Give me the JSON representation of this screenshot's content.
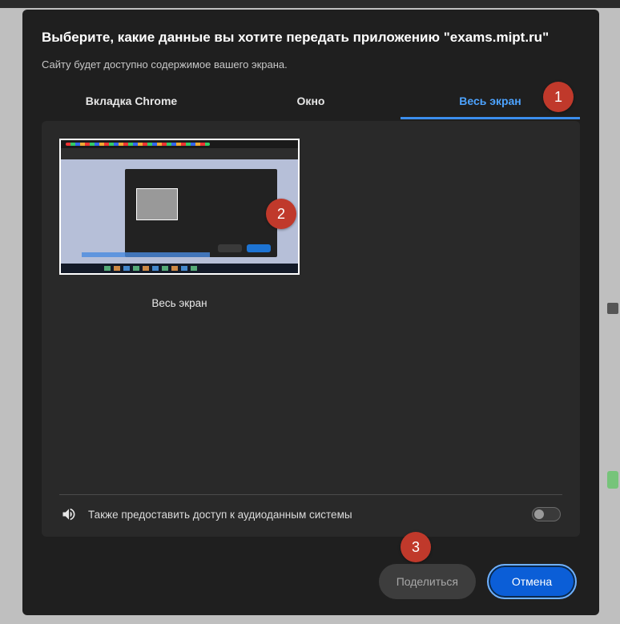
{
  "dialog": {
    "title": "Выберите, какие данные вы хотите передать приложению \"exams.mipt.ru\"",
    "subtitle": "Сайту будет доступно содержимое вашего экрана."
  },
  "tabs": {
    "chrome": "Вкладка Chrome",
    "window": "Окно",
    "screen": "Весь экран"
  },
  "tile": {
    "label": "Весь экран"
  },
  "audio": {
    "label": "Также предоставить доступ к аудиоданным системы"
  },
  "buttons": {
    "share": "Поделиться",
    "cancel": "Отмена"
  },
  "callouts": {
    "one": "1",
    "two": "2",
    "three": "3"
  }
}
